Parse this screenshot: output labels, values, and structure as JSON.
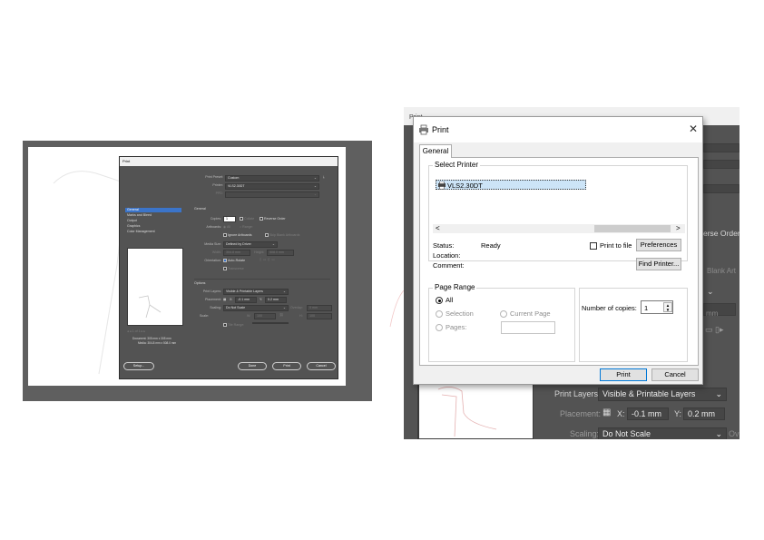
{
  "left_dialog": {
    "title": "Print",
    "print_preset_label": "Print Preset:",
    "print_preset_value": "Custom",
    "printer_label": "Printer:",
    "printer_value": "VLS2.30DT",
    "ppd_label": "PPD:",
    "nav_items": [
      "General",
      "Marks and Bleed",
      "Output",
      "Graphics",
      "Color Management"
    ],
    "section_general": "General",
    "copies_label": "Copies:",
    "copies_value": "1",
    "collate_label": "Collate",
    "reverse_order_label": "Reverse Order",
    "artboards_label": "Artboards:",
    "all_label": "All",
    "range_label": "Range:",
    "ignore_artboards_label": "Ignore Artboards",
    "skip_blank_label": "Skip Blank Artboards",
    "media_size_label": "Media Size:",
    "media_size_value": "Defined by Driver",
    "width_label": "Width:",
    "width_value": "304.8 mm",
    "height_label": "Height:",
    "height_value": "508.0 mm",
    "orientation_label": "Orientation:",
    "auto_rotate_label": "Auto-Rotate",
    "transverse_label": "Transverse",
    "options_label": "Options",
    "print_layers_label": "Print Layers:",
    "print_layers_value": "Visible & Printable Layers",
    "placement_label": "Placement:",
    "x_label": "X:",
    "x_value": "-0.1 mm",
    "y_label": "Y:",
    "y_value": "0.2 mm",
    "scaling_label": "Scaling:",
    "scaling_value": "Do Not Scale",
    "overlap_label": "Overlap:",
    "overlap_value": "0 mm",
    "scale_label": "Scale:",
    "w_label": "W:",
    "w_value": "100",
    "h_label": "H:",
    "h_value": "100",
    "tile_range_label": "Tile Range:",
    "preview_page": "1 of 1",
    "document_info": "Document: 305 mm x 305 mm",
    "media_info": "Media: 304.8 mm x 508.0 mm",
    "setup_button": "Setup...",
    "done_button": "Done",
    "print_button": "Print",
    "cancel_button": "Cancel"
  },
  "right_bg": {
    "title": "Print",
    "reverse_order_partial": "erse Order",
    "blank_art_partial": "Blank Art",
    "mm_partial": "mm",
    "print_layers_label": "Print Layers:",
    "print_layers_value": "Visible & Printable Layers",
    "placement_label": "Placement:",
    "x_label": "X:",
    "x_value": "-0.1 mm",
    "y_label": "Y:",
    "y_value": "0.2 mm",
    "scaling_label": "Scaling:",
    "scaling_value": "Do Not Scale",
    "overlap_partial": "Ov"
  },
  "win_dialog": {
    "title": "Print",
    "tab_general": "General",
    "select_printer_label": "Select Printer",
    "printer_item": "VLS2.30DT",
    "status_label": "Status:",
    "status_value": "Ready",
    "location_label": "Location:",
    "comment_label": "Comment:",
    "print_to_file_label": "Print to file",
    "preferences_button": "Preferences",
    "find_printer_button": "Find Printer...",
    "page_range_label": "Page Range",
    "all_label": "All",
    "selection_label": "Selection",
    "current_page_label": "Current Page",
    "pages_label": "Pages:",
    "copies_label": "Number of copies:",
    "copies_value": "1",
    "print_button": "Print",
    "cancel_button": "Cancel"
  },
  "colors": {
    "ai_panel": "#535353",
    "ai_selection": "#3b74c9",
    "win_accent": "#0078d7",
    "win_bg": "#f0f0f0"
  }
}
